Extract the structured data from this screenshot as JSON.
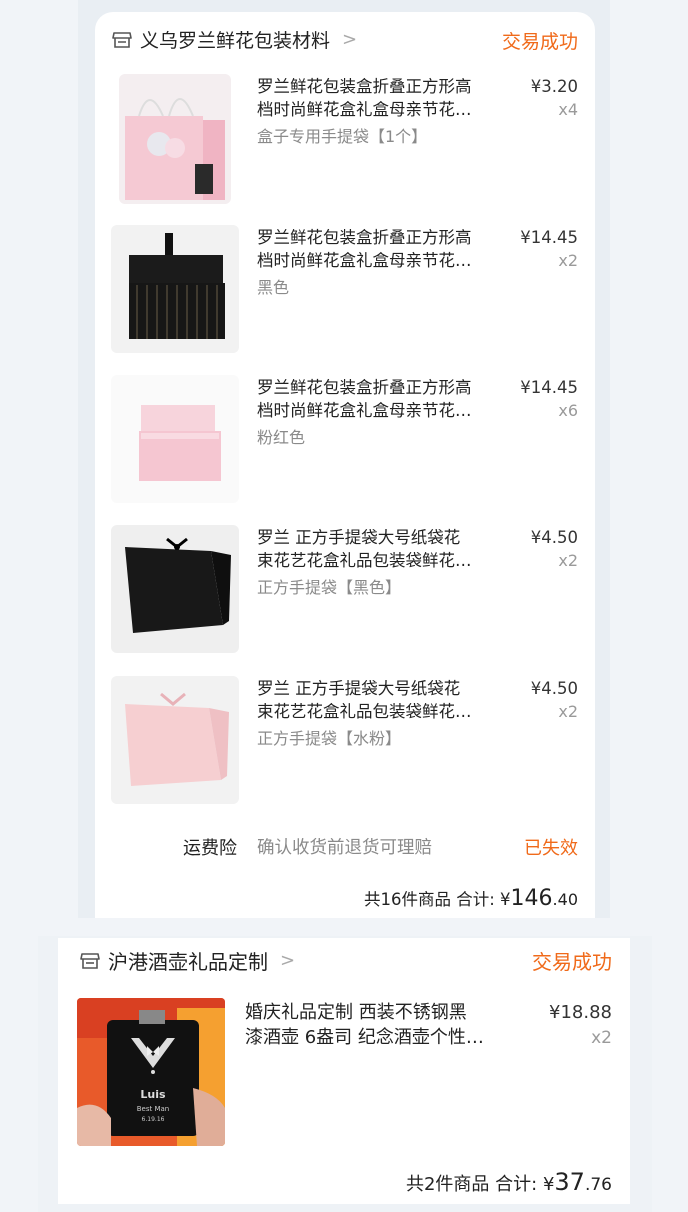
{
  "order1": {
    "shop_name": "义乌罗兰鲜花包装材料",
    "status": "交易成功",
    "items": [
      {
        "title": "罗兰鲜花包装盒折叠正方形高\n档时尚鲜花盒礼盒母亲节花…",
        "variant": "盒子专用手提袋【1个】",
        "price": "¥3.20",
        "qty": "x4"
      },
      {
        "title": "罗兰鲜花包装盒折叠正方形高\n档时尚鲜花盒礼盒母亲节花…",
        "variant": "黑色",
        "price": "¥14.45",
        "qty": "x2"
      },
      {
        "title": "罗兰鲜花包装盒折叠正方形高\n档时尚鲜花盒礼盒母亲节花…",
        "variant": "粉红色",
        "price": "¥14.45",
        "qty": "x6"
      },
      {
        "title": "罗兰  正方手提袋大号纸袋花\n束花艺花盒礼品包装袋鲜花…",
        "variant": "正方手提袋【黑色】",
        "price": "¥4.50",
        "qty": "x2"
      },
      {
        "title": "罗兰  正方手提袋大号纸袋花\n束花艺花盒礼品包装袋鲜花…",
        "variant": "正方手提袋【水粉】",
        "price": "¥4.50",
        "qty": "x2"
      }
    ],
    "insurance": {
      "label": "运费险",
      "desc": "确认收货前退货可理赔",
      "status": "已失效"
    },
    "summary": {
      "count": "共16件商品",
      "label": "合计:",
      "currency": "¥",
      "int": "146",
      "dec": ".40"
    }
  },
  "order2": {
    "shop_name": "沪港酒壶礼品定制",
    "status": "交易成功",
    "items": [
      {
        "title": "婚庆礼品定制  西装不锈钢黑\n漆酒壶 6盎司 纪念酒壶个性…",
        "price": "¥18.88",
        "qty": "x2",
        "engraving": [
          "Luis",
          "Best Man",
          "6.19.16"
        ]
      }
    ],
    "summary": {
      "count": "共2件商品",
      "label": "合计:",
      "currency": "¥",
      "int": "37",
      "dec": ".76"
    }
  },
  "colors": {
    "accent": "#f06a1a",
    "muted": "#8a8a8a",
    "bg": "#f1f4f8"
  }
}
